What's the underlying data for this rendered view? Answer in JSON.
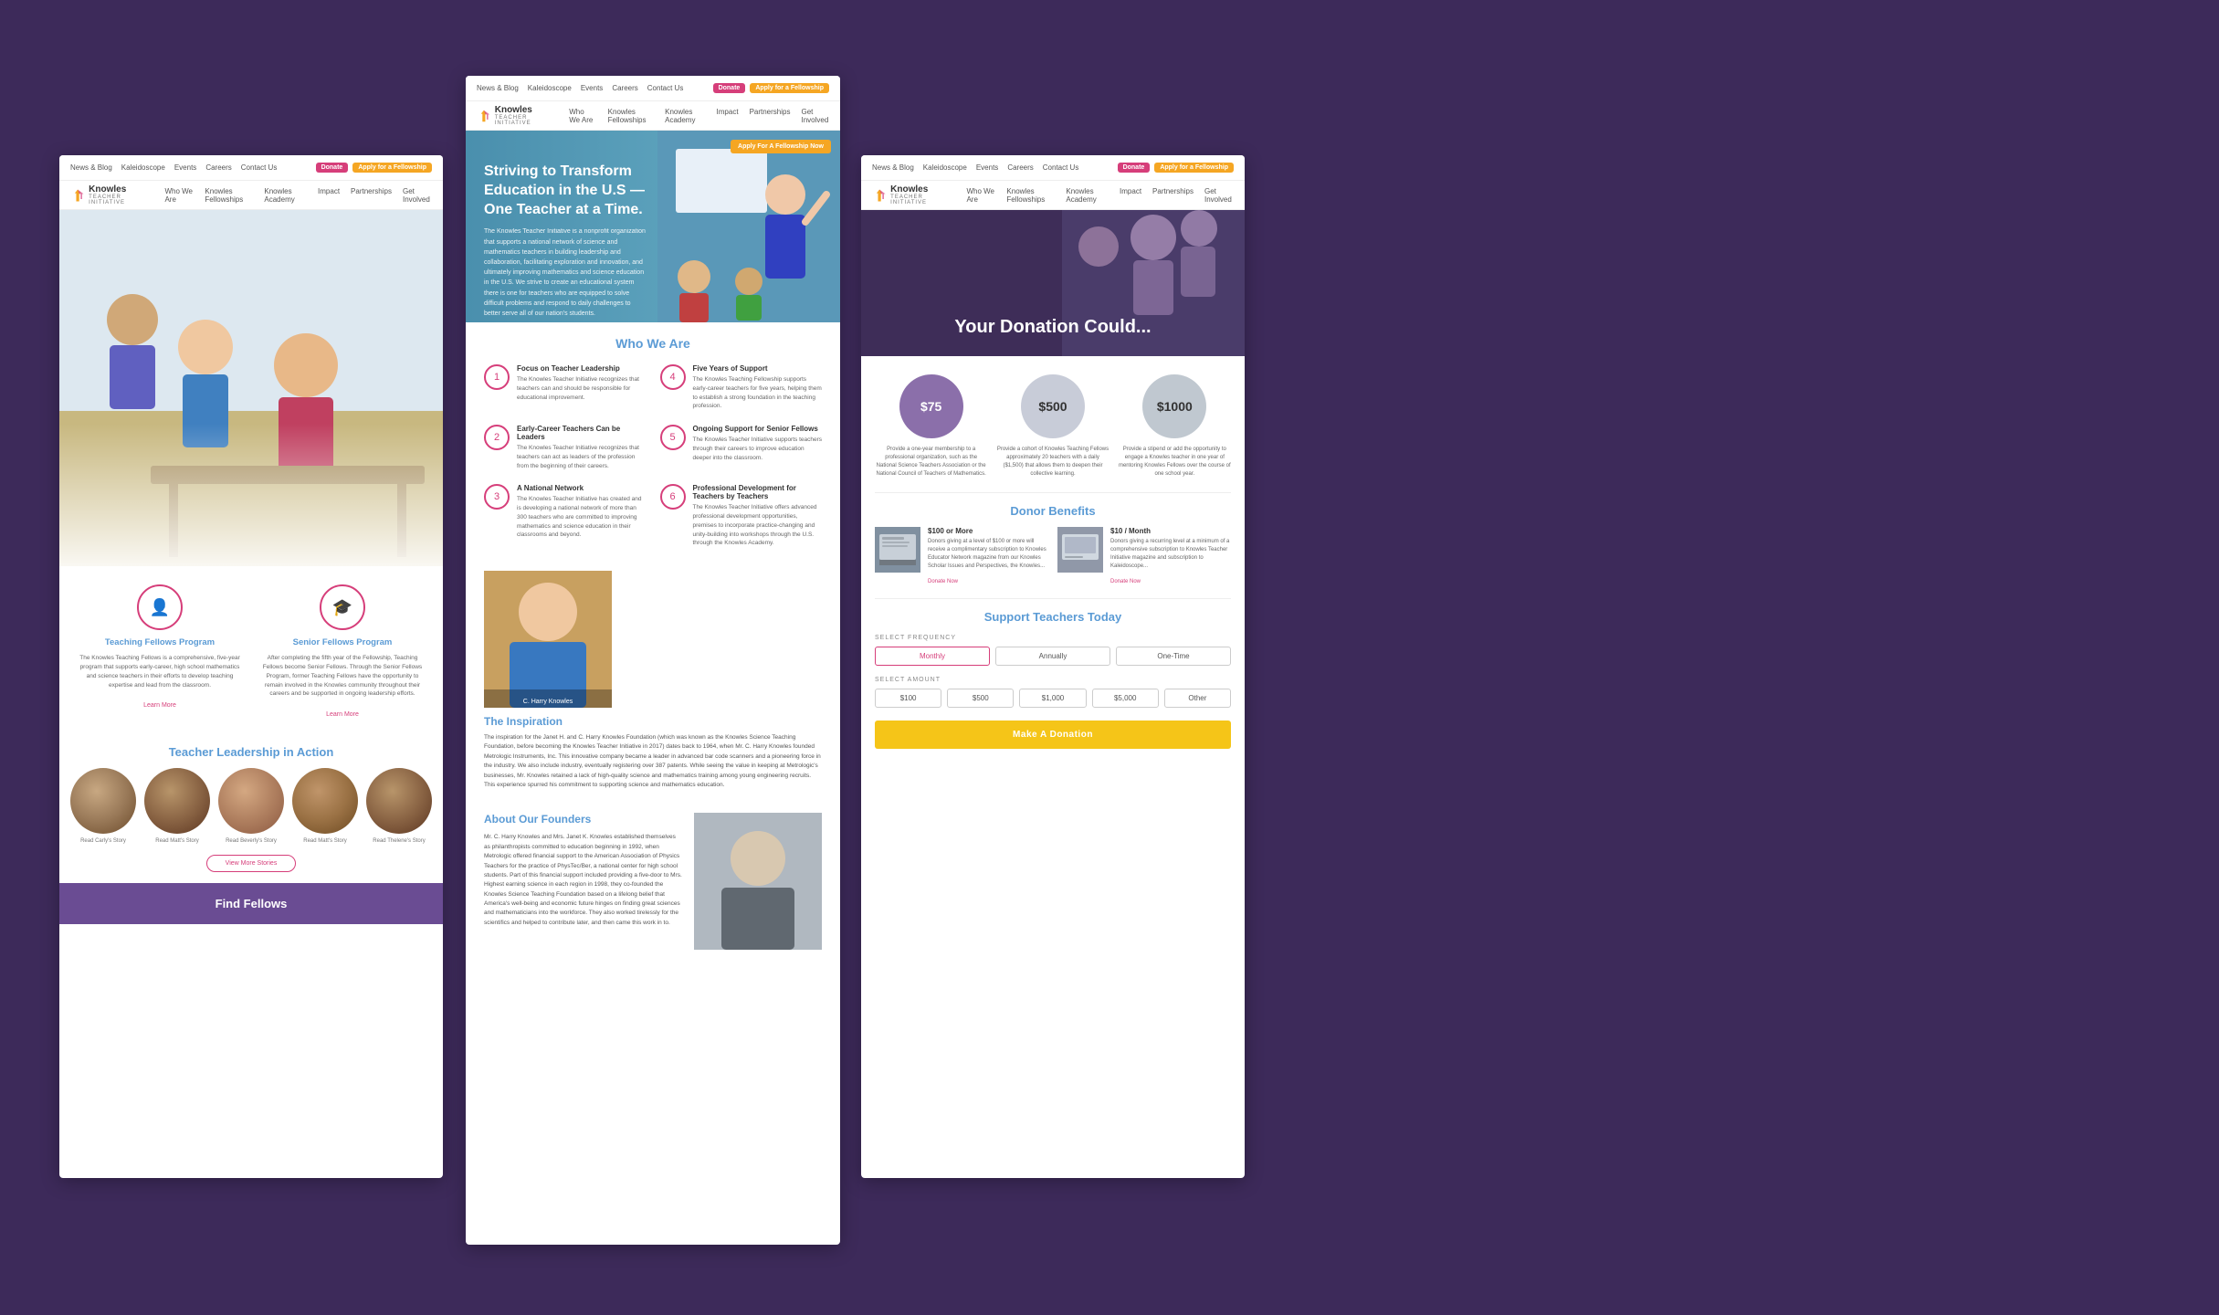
{
  "background": {
    "color": "#3d2a5a"
  },
  "left_panel": {
    "nav_top": {
      "links": [
        "News & Blog",
        "Kaleidoscope",
        "Events",
        "Careers",
        "Contact Us"
      ],
      "donate_label": "Donate",
      "apply_label": "Apply for a Fellowship"
    },
    "nav_main": {
      "logo_name": "Knowles",
      "logo_sub": "TEACHER INITIATIVE",
      "menu_items": [
        "Who We Are",
        "Knowles Fellowships",
        "Knowles Academy",
        "Impact",
        "Partnerships",
        "Get Involved"
      ]
    },
    "programs": {
      "section": [
        {
          "icon": "👤",
          "title": "Teaching Fellows Program",
          "desc": "The Knowles Teaching Fellows is a comprehensive, five-year program that supports early-career, high school mathematics and science teachers in their efforts to develop teaching expertise and lead from the classroom.",
          "link": "Learn More"
        },
        {
          "icon": "🎓",
          "title": "Senior Fellows Program",
          "desc": "After completing the fifth year of the Fellowship, Teaching Fellows become Senior Fellows. Through the Senior Fellows Program, former Teaching Fellows have the opportunity to remain involved in the Knowles community throughout their careers and be supported in ongoing leadership efforts.",
          "link": "Learn More"
        }
      ]
    },
    "teacher_leadership": {
      "title": "Teacher Leadership in Action",
      "fellows": [
        {
          "label": "Read Carly's Story"
        },
        {
          "label": "Read Matt's Story"
        },
        {
          "label": "Read Beverly's Story"
        },
        {
          "label": "Read Matt's Story"
        },
        {
          "label": "Read Thelene's Story"
        }
      ],
      "view_btn": "View More Stories"
    },
    "find_fellows": {
      "title": "Find Fellows"
    }
  },
  "center_panel": {
    "nav_top": {
      "links": [
        "News & Blog",
        "Kaleidoscope",
        "Events",
        "Careers",
        "Contact Us"
      ],
      "donate_label": "Donate",
      "apply_label": "Apply for a Fellowship"
    },
    "nav_main": {
      "logo_name": "Knowles",
      "logo_sub": "TEACHER INITIATIVE",
      "menu_items": [
        "Who We Are",
        "Knowles Fellowships",
        "Knowles Academy",
        "Impact",
        "Partnerships",
        "Get Involved"
      ]
    },
    "hero": {
      "title": "Striving to Transform Education in the U.S — One Teacher at a Time.",
      "desc": "The Knowles Teacher Initiative is a nonprofit organization that supports a national network of science and mathematics teachers in building leadership and collaboration, facilitating exploration and innovation, and ultimately improving mathematics and science education in the U.S. We strive to create an educational system there is one for teachers who are equipped to solve difficult problems and respond to daily challenges to better serve all of our nation's students.",
      "apply_btn": "Apply For A Fellowship Now"
    },
    "who_we_are": {
      "title": "Who We Are",
      "features": [
        {
          "num": "1",
          "title": "Focus on Teacher Leadership",
          "desc": "The Knowles Teacher Initiative recognizes that teachers can and should be responsible for educational improvement."
        },
        {
          "num": "4",
          "title": "Five Years of Support",
          "desc": "The Knowles Teaching Fellowship supports early-career teachers for five years, helping them to establish a strong foundation in the teaching profession."
        },
        {
          "num": "2",
          "title": "Early-Career Teachers Can be Leaders",
          "desc": "The Knowles Teacher Initiative recognizes that teachers can act as leaders of the profession from the beginning of their careers."
        },
        {
          "num": "5",
          "title": "Ongoing Support for Senior Fellows",
          "desc": "The Knowles Teacher Initiative supports teachers through their careers to improve education deeper into the classroom."
        },
        {
          "num": "3",
          "title": "A National Network",
          "desc": "The Knowles Teacher Initiative has created and is developing a national network of more than 300 teachers who are committed to improving mathematics and science education in their classrooms and beyond."
        },
        {
          "num": "6",
          "title": "Professional Development for Teachers by Teachers",
          "desc": "The Knowles Teacher Initiative offers advanced professional development opportunities, premises to incorporate practice-changing and unity-building into workshops through the U.S. through the Knowles Academy."
        }
      ]
    },
    "inspiration": {
      "title": "The Inspiration",
      "desc": "The inspiration for the Janet H. and C. Harry Knowles Foundation (which was known as the Knowles Science Teaching Foundation, before becoming the Knowles Teacher Initiative in 2017) dates back to 1964, when Mr. C. Harry Knowles founded Metrologic Instruments, Inc. This innovative company became a leader in advanced bar code scanners and a pioneering force in the industry. We also include industry, eventually registering over 387 patents. While seeing the value in keeping at Metrologic's businesses, Mr. Knowles retained a lack of high-quality science and mathematics training among young engineering recruits. This experience spurred his commitment to supporting science and mathematics education.",
      "photo_caption": "C. Harry Knowles"
    },
    "about": {
      "title": "About Our Founders",
      "desc": "Mr. C. Harry Knowles and Mrs. Janet K. Knowles established themselves as philanthropists committed to education beginning in 1992, when Metrologic offered financial support to the American Association of Physics Teachers for the practice of PhysTec/Ber, a national center for high school students. Part of this financial support included providing a five-door to Mrs. Highest earning science in each region in 1998, they co-founded the Knowles Science Teaching Foundation based on a lifelong belief that America's well-being and economic future hinges on finding great sciences and mathematicians into the workforce. They also worked tirelessly for the scientifics and helped to contribute later, and then came this work in to."
    }
  },
  "right_panel": {
    "nav_top": {
      "links": [
        "News & Blog",
        "Kaleidoscope",
        "Events",
        "Careers",
        "Contact Us"
      ],
      "donate_label": "Donate",
      "apply_label": "Apply for a Fellowship"
    },
    "nav_main": {
      "logo_name": "Knowles",
      "logo_sub": "TEACHER INITIATIVE",
      "menu_items": [
        "Who We Are",
        "Knowles Fellowships",
        "Knowles Academy",
        "Impact",
        "Partnerships",
        "Get Involved"
      ]
    },
    "hero": {
      "title": "Your Donation Could..."
    },
    "donation_cards": [
      {
        "amount": "$75",
        "desc": "Provide a one-year membership to a professional organization, such as the National Science Teachers Association or the National Council of Teachers of Mathematics."
      },
      {
        "amount": "$500",
        "desc": "Provide a cohort of Knowles Teaching Fellows approximately 20 teachers with a daily ($1,500) that allows them to deepen their collective learning."
      },
      {
        "amount": "$1000",
        "desc": "Provide a stipend or add the opportunity to engage a Knowles teacher in one year of mentoring Knowles Fellows over the course of one school year."
      }
    ],
    "donor_benefits": {
      "title": "Donor Benefits",
      "items": [
        {
          "threshold": "$100 or More",
          "desc": "Donors giving at a level of $100 or more will receive a complimentary subscription to Knowles Educator Network magazine from our Knowles Scholar Issues and Perspectives, the Knowles...",
          "link": "Donate Now"
        },
        {
          "threshold": "$10 / Month",
          "desc": "Donors giving a recurring level at a minimum of a comprehensive subscription to Knowles Teacher Initiative magazine and subscription to Kaleidoscope...",
          "link": "Donate Now"
        }
      ]
    },
    "support": {
      "title": "Support Teachers Today",
      "frequency_label": "SELECT FREQUENCY",
      "frequency_options": [
        "Monthly",
        "Annually",
        "One-Time"
      ],
      "active_frequency": "Monthly",
      "amount_label": "SELECT AMOUNT",
      "amount_options": [
        "$100",
        "$500",
        "$1,000",
        "$5,000",
        "Other"
      ],
      "donate_btn": "Make A Donation"
    }
  }
}
